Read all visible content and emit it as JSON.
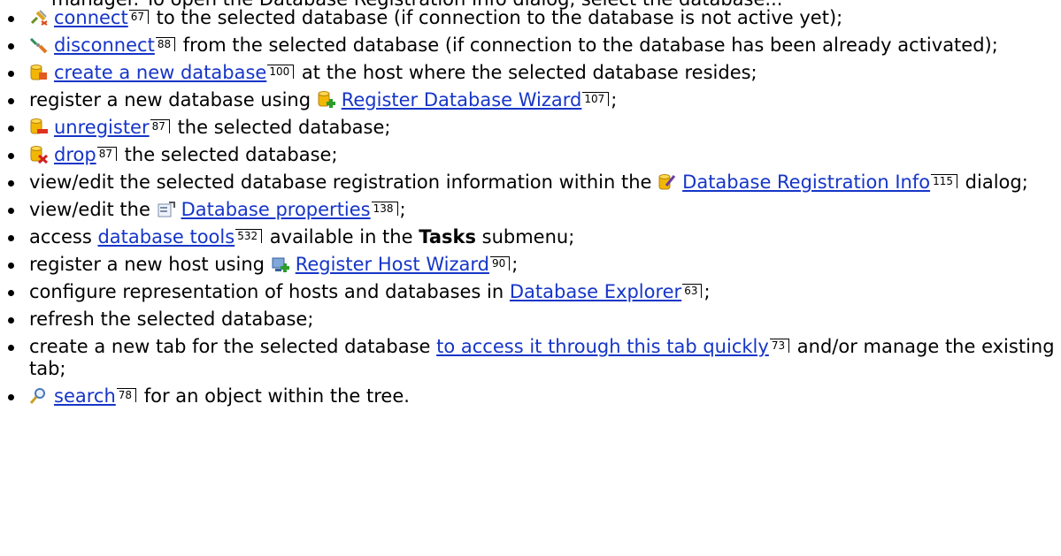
{
  "top_text": "manager. To open the Database Registration Info dialog, select the database...",
  "items": {
    "connect": {
      "link": "connect",
      "page": "67",
      "text": " to the selected database (if connection to the database is not active yet);"
    },
    "disconnect": {
      "link": "disconnect",
      "page": "88",
      "text": " from the selected database (if connection to the database has been already activated);"
    },
    "create": {
      "link": "create a new database",
      "page": "100",
      "text": " at the host where the selected database resides;"
    },
    "register": {
      "pre": "register a new database using ",
      "link": "Register Database Wizard",
      "page": "107",
      "text": ";"
    },
    "unregister": {
      "link": "unregister",
      "page": "87",
      "text": " the selected database;"
    },
    "drop": {
      "link": "drop",
      "page": "87",
      "text": " the selected database;"
    },
    "reginfo": {
      "pre": "view/edit the selected database registration information within the ",
      "link": "Database Registration Info",
      "page": "115",
      "text": " dialog;"
    },
    "props": {
      "pre": "view/edit the ",
      "link": "Database properties",
      "page": "138",
      "text": ";"
    },
    "tools": {
      "pre": "access ",
      "link": "database tools",
      "page": "532",
      "text_pre_bold": " available in the ",
      "bold": "Tasks",
      "text": " submenu;"
    },
    "reghost": {
      "pre": "register a new host using ",
      "link": "Register Host Wizard",
      "page": "90",
      "text": ";"
    },
    "configure": {
      "pre": "configure representation of hosts and databases in ",
      "link": "Database Explorer",
      "page": "63",
      "text": ";"
    },
    "refresh": {
      "pre": "refresh the selected database;"
    },
    "tab": {
      "pre": "create a new tab for the selected database ",
      "link": "to access it through this tab quickly",
      "page": "73",
      "text": " and/or manage the existing tab;"
    },
    "search": {
      "link": "search",
      "page": "78",
      "text": " for an object within the tree."
    }
  },
  "icons": {
    "connect": "plug-connect-icon",
    "disconnect": "plug-disconnect-icon",
    "create": "database-new-icon",
    "register": "database-add-icon",
    "unregister": "database-remove-icon",
    "drop": "database-drop-icon",
    "reginfo": "database-edit-icon",
    "props": "properties-icon",
    "reghost": "host-add-icon",
    "search": "magnifier-icon"
  },
  "colors": {
    "link": "#1535c8"
  }
}
